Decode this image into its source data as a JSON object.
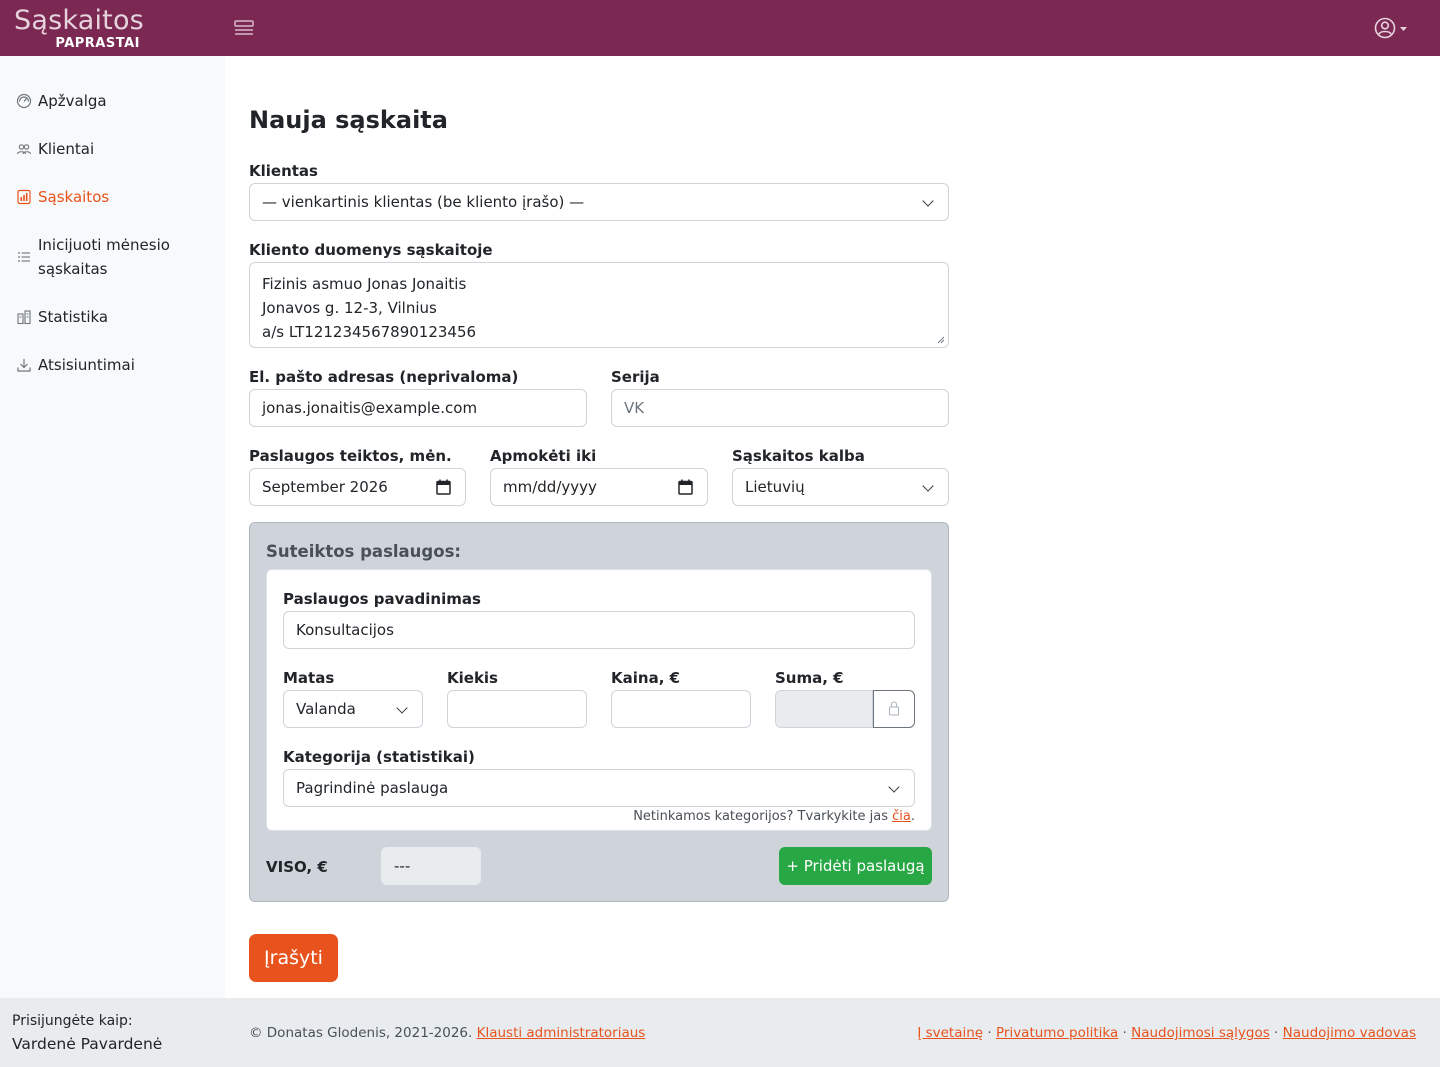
{
  "brand": {
    "main": "Sąskaitos",
    "sub": "PAPRASTAI"
  },
  "colors": {
    "brand": "#7b2852",
    "accent": "#e8531d",
    "success": "#28a745"
  },
  "sidebar": {
    "items": [
      {
        "label": "Apžvalga",
        "icon": "dashboard-icon"
      },
      {
        "label": "Klientai",
        "icon": "people-icon"
      },
      {
        "label": "Sąskaitos",
        "icon": "invoice-chart-icon",
        "active": true
      },
      {
        "label_line1": "Inicijuoti mėnesio",
        "label_line2": "sąskaitas",
        "icon": "list-icon"
      },
      {
        "label": "Statistika",
        "icon": "buildings-icon"
      },
      {
        "label": "Atsisiuntimai",
        "icon": "download-icon"
      }
    ]
  },
  "form": {
    "title": "Nauja sąskaita",
    "client": {
      "label": "Klientas",
      "value": "— vienkartinis klientas (be kliento įrašo) —"
    },
    "client_details": {
      "label": "Kliento duomenys sąskaitoje",
      "lines": [
        "Fizinis asmuo Jonas Jonaitis",
        "Jonavos g. 12-3, Vilnius",
        "a/s LT121234567890123456"
      ]
    },
    "email": {
      "label": "El. pašto adresas (neprivaloma)",
      "value": "jonas.jonaitis@example.com"
    },
    "series": {
      "label": "Serija",
      "value": "VK"
    },
    "service_month": {
      "label": "Paslaugos teiktos, mėn.",
      "value": "September 2026"
    },
    "due_date": {
      "label": "Apmokėti iki",
      "placeholder": "mm/dd/yyyy"
    },
    "language": {
      "label": "Sąskaitos kalba",
      "value": "Lietuvių"
    }
  },
  "services": {
    "title": "Suteiktos paslaugos:",
    "name_label": "Paslaugos pavadinimas",
    "name_value": "Konsultacijos",
    "unit_label": "Matas",
    "unit_value": "Valanda",
    "qty_label": "Kiekis",
    "price_label": "Kaina, €",
    "sum_label": "Suma, €",
    "category_label": "Kategorija (statistikai)",
    "category_value": "Pagrindinė paslauga",
    "hint_text": "Netinkamos kategorijos? Tvarkykite jas ",
    "hint_link": "čia",
    "hint_end": ".",
    "total_label": "VISO, €",
    "total_value": "---",
    "add_button": "+ Pridėti paslaugą"
  },
  "save_button": "Įrašyti",
  "footer": {
    "logged_in_label": "Prisijungėte kaip:",
    "user_name": "Vardenė Pavardenė",
    "copyright": "© Donatas Glodenis, 2021-2026. ",
    "contact_link": "Klausti administratoriaus",
    "links": [
      "Į svetainę",
      "Privatumo politika",
      "Naudojimosi sąlygos",
      "Naudojimo vadovas"
    ],
    "separator": " · "
  }
}
